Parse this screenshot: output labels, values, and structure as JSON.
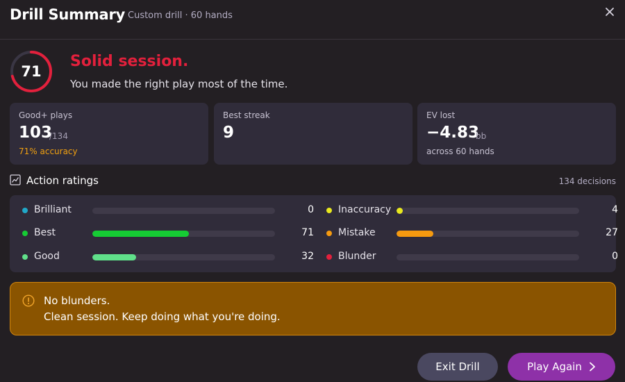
{
  "header": {
    "title": "Drill Summary",
    "subtitle": "Custom drill · 60 hands",
    "close_icon": "close-icon"
  },
  "score": {
    "value": "71",
    "progress": 0.71,
    "ring_color": "#e3203c",
    "headline": "Solid session.",
    "tagline": "You made the right play most of the time."
  },
  "stats": [
    {
      "label": "Good+ plays",
      "value": "103",
      "unit": "/134",
      "note": "71% accuracy",
      "note_color": "#f0a010"
    },
    {
      "label": "Best streak",
      "value": "9"
    },
    {
      "label": "EV lost",
      "value": "−4.83",
      "unit": "bb",
      "note": "across 60 hands",
      "note_color": "#c7c2d2"
    }
  ],
  "ratings": {
    "title": "Action ratings",
    "icon": "chart-icon",
    "count_label": "134 decisions",
    "max": 134,
    "items": [
      {
        "label": "Brilliant",
        "count": 0,
        "color": "#21a8c8"
      },
      {
        "label": "Best",
        "count": 71,
        "color": "#16cc34"
      },
      {
        "label": "Good",
        "count": 32,
        "color": "#60e08a"
      },
      {
        "label": "Inaccuracy",
        "count": 4,
        "color": "#e8e81e"
      },
      {
        "label": "Mistake",
        "count": 27,
        "color": "#f59a10"
      },
      {
        "label": "Blunder",
        "count": 0,
        "color": "#e3203c"
      }
    ]
  },
  "notice": {
    "icon": "info-icon",
    "title": "No blunders.",
    "body": "Clean session. Keep doing what you're doing."
  },
  "actions": {
    "exit_label": "Exit Drill",
    "play_label": "Play Again"
  }
}
